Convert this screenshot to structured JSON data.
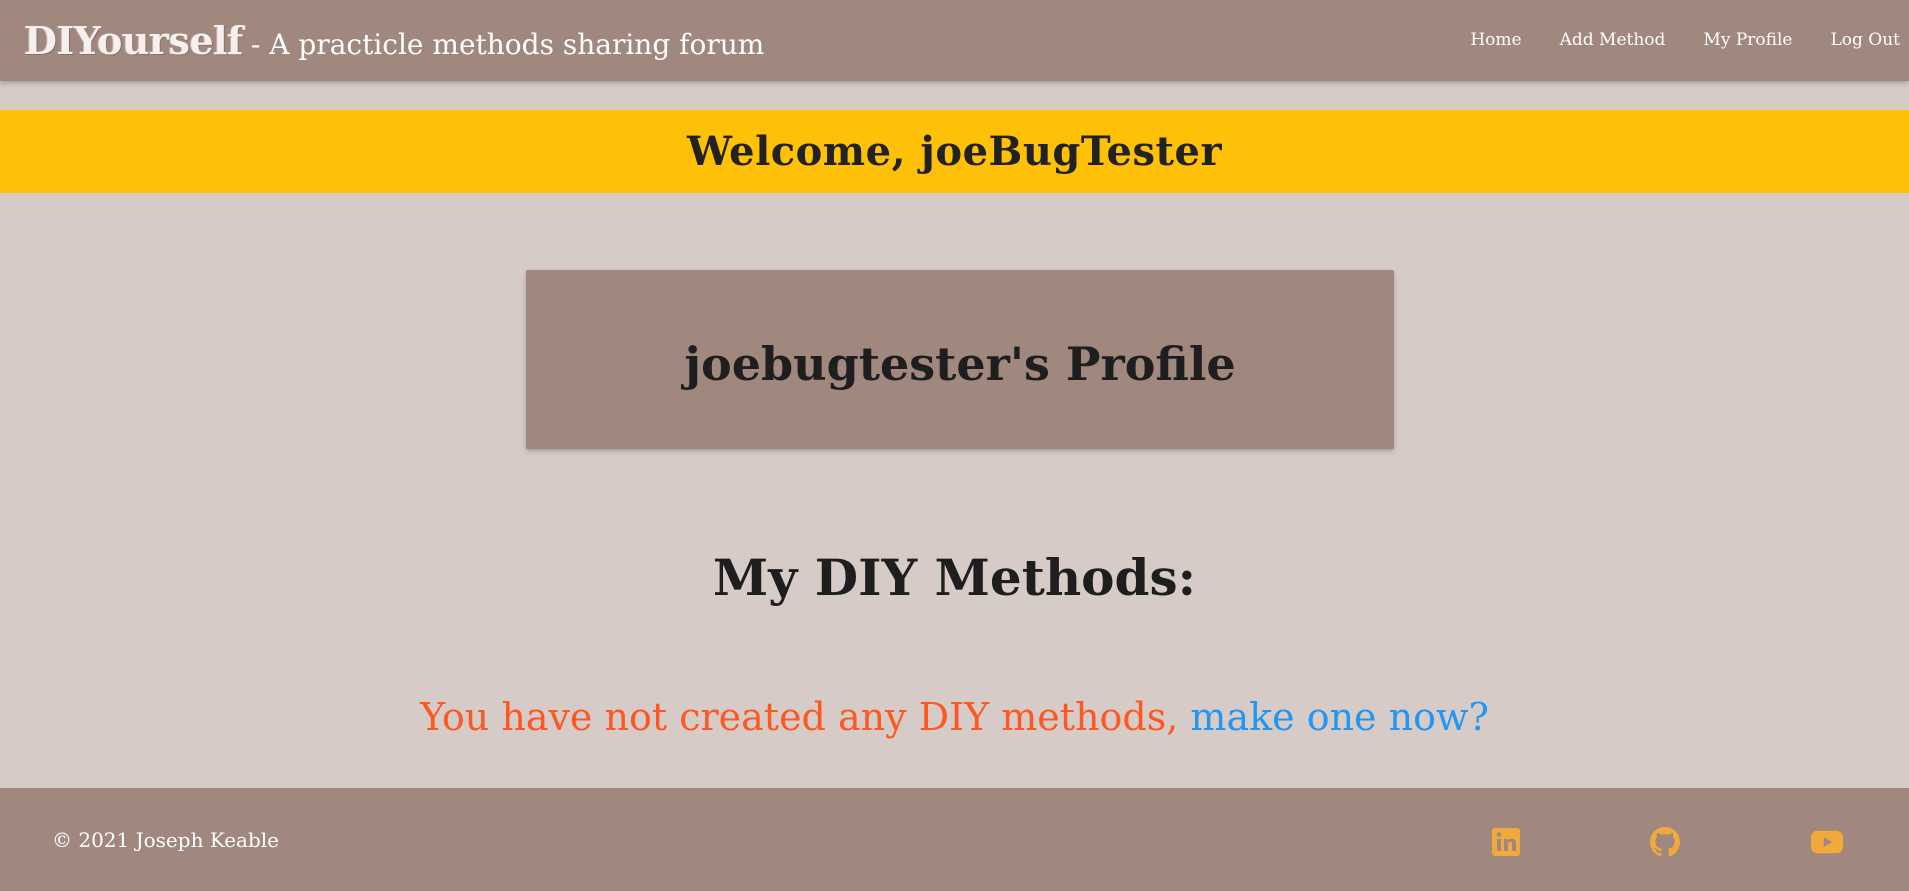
{
  "navbar": {
    "brand_logo": "DIYourself",
    "brand_tagline": "- A practicle methods sharing forum",
    "links": [
      {
        "label": "Home"
      },
      {
        "label": "Add Method"
      },
      {
        "label": "My Profile"
      },
      {
        "label": "Log Out"
      }
    ]
  },
  "welcome": {
    "text": "Welcome, joeBugTester"
  },
  "profile": {
    "title": "joebugtester's Profile"
  },
  "methods": {
    "heading": "My DIY Methods:",
    "empty_text": "You have not created any DIY methods, ",
    "empty_link": "make one now?"
  },
  "footer": {
    "copyright": "© 2021 Joseph Keable",
    "social": [
      {
        "icon": "linkedin-icon"
      },
      {
        "icon": "github-icon"
      },
      {
        "icon": "youtube-icon"
      }
    ]
  },
  "colors": {
    "navbar_bg": "#a1887f",
    "page_bg": "#d7cbc7",
    "welcome_bg": "#ffc107",
    "empty_text": "#ff5722",
    "empty_link": "#2196f3",
    "social_icon": "#f2a93b"
  }
}
